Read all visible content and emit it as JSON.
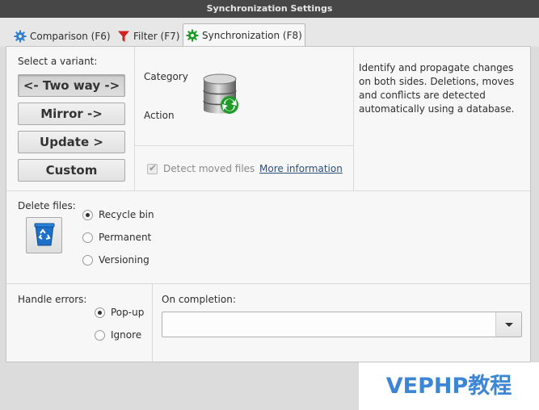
{
  "window": {
    "title": "Synchronization Settings"
  },
  "tabs": [
    {
      "label": "Comparison (F6)",
      "icon": "gear-icon",
      "icon_color": "#2f7fd0"
    },
    {
      "label": "Filter (F7)",
      "icon": "funnel-icon",
      "icon_color": "#d31f1f"
    },
    {
      "label": "Synchronization (F8)",
      "icon": "gear-icon",
      "icon_color": "#1f9b2a",
      "active": true
    }
  ],
  "variant": {
    "heading": "Select a variant:",
    "buttons": [
      {
        "label": "<- Two way ->",
        "pressed": true
      },
      {
        "label": "Mirror ->"
      },
      {
        "label": "Update >"
      },
      {
        "label": "Custom"
      }
    ]
  },
  "details": {
    "category_label": "Category",
    "action_label": "Action",
    "icon": "database-sync-icon",
    "detect_moved_label": "Detect moved files",
    "detect_moved_checked": true,
    "more_info_label": "More information"
  },
  "description": "Identify and propagate changes on both sides. Deletions, moves and conflicts are detected automatically using a database.",
  "delete_files": {
    "heading": "Delete files:",
    "icon": "recycle-bin-icon",
    "options": [
      "Recycle bin",
      "Permanent",
      "Versioning"
    ],
    "selected": 0
  },
  "handle_errors": {
    "heading": "Handle errors:",
    "options": [
      "Pop-up",
      "Ignore"
    ],
    "selected": 0
  },
  "on_completion": {
    "heading": "On completion:",
    "value": ""
  },
  "watermark": {
    "text": "VEPHP教程"
  },
  "colors": {
    "titlebar": "#474747",
    "link": "#2c4f7e",
    "watermark": "#3d86d6"
  }
}
